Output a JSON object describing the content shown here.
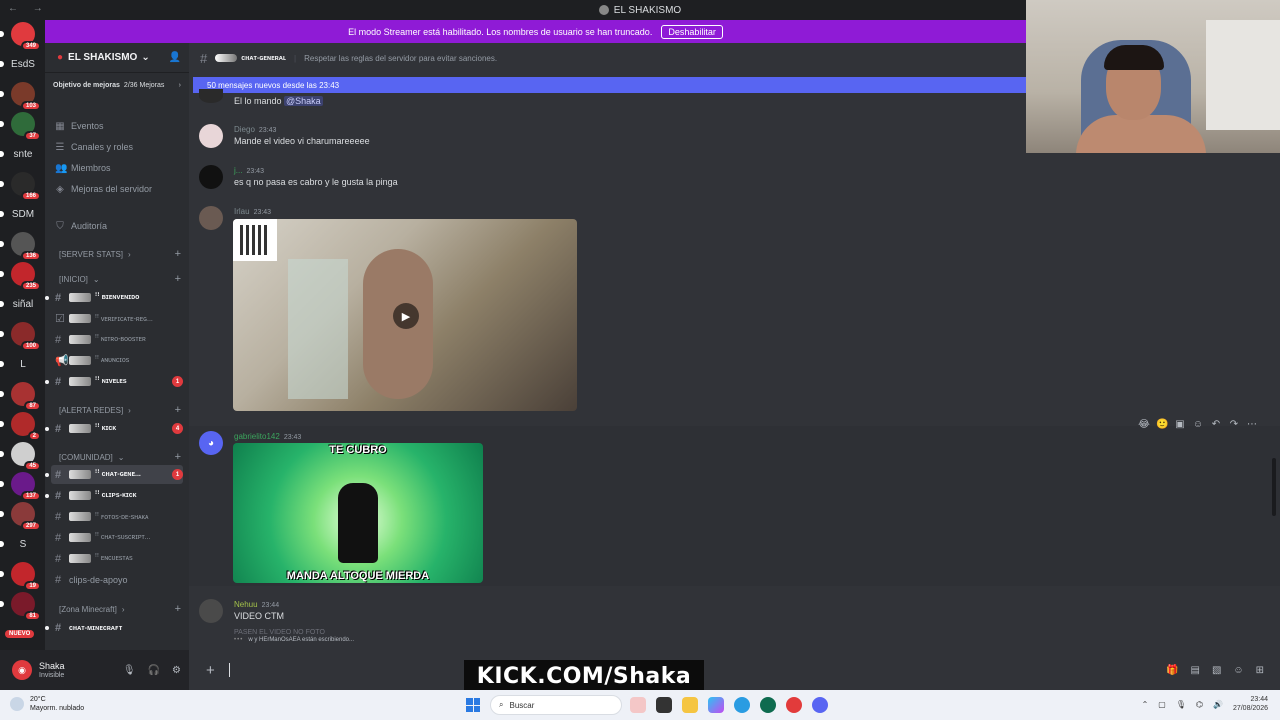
{
  "topbar": {
    "server_name": "EL SHAKISMO",
    "nav": "← →"
  },
  "banner": {
    "text": "El modo Streamer está habilitado. Los nombres de usuario se han truncado.",
    "button": "Deshabilitar"
  },
  "rail": [
    {
      "label": "349",
      "badge": "349",
      "kind": "icon"
    },
    {
      "label": "EsdS",
      "kind": "text"
    },
    {
      "label": "",
      "badge": "103",
      "kind": "icon"
    },
    {
      "label": "",
      "badge": "37",
      "kind": "icon"
    },
    {
      "label": "snte",
      "kind": "text"
    },
    {
      "label": "",
      "badge": "166",
      "kind": "icon"
    },
    {
      "label": "SDM",
      "kind": "text"
    },
    {
      "label": "",
      "badge": "136",
      "kind": "icon"
    },
    {
      "label": "",
      "badge": "235",
      "kind": "icon"
    },
    {
      "label": "siñal",
      "kind": "text"
    },
    {
      "label": "",
      "badge": "100",
      "kind": "icon"
    },
    {
      "label": "L",
      "kind": "text"
    },
    {
      "label": "",
      "badge": "87",
      "kind": "icon"
    },
    {
      "label": "",
      "badge": "2",
      "kind": "icon"
    },
    {
      "label": "",
      "badge": "45",
      "kind": "icon"
    },
    {
      "label": "",
      "badge": "137",
      "kind": "icon"
    },
    {
      "label": "",
      "badge": "297",
      "kind": "icon"
    },
    {
      "label": "S",
      "kind": "text"
    },
    {
      "label": "",
      "badge": "19",
      "kind": "icon"
    },
    {
      "label": "",
      "badge": "81",
      "kind": "icon"
    }
  ],
  "rail_nuevo": "NUEVO",
  "sidebar": {
    "server": "EL SHAKISMO",
    "boost_label": "Objetivo de mejoras",
    "boost_value": "2/36 Mejoras",
    "nav": [
      "Eventos",
      "Canales y roles",
      "Miembros",
      "Mejoras del servidor",
      "Auditoría"
    ],
    "categories": [
      "[SERVER STATS]",
      "[INICIO]",
      "[ALERTA REDES]",
      "[COMUNIDAD]",
      "[Zona Minecraft]"
    ],
    "channels": [
      {
        "name": "ꜝꜝ ʙɪᴇɴᴠᴇɴɪᴅᴏ",
        "count": ""
      },
      {
        "name": "ꜝꜝ ᴠᴇʀɪꜰɪᴄᴀᴛᴇ-ʀᴇɢ...",
        "count": ""
      },
      {
        "name": "ꜝꜝ ɴɪᴛʀᴏ-ʙᴏᴏsᴛᴇʀ",
        "count": ""
      },
      {
        "name": "ꜝꜝ ᴀɴᴜɴᴄɪᴏs",
        "count": ""
      },
      {
        "name": "ꜝꜝ ɴɪᴠᴇʟᴇs",
        "count": "1"
      },
      {
        "name": "ꜝꜝ ᴋɪᴄᴋ",
        "count": "4"
      },
      {
        "name": "ꜝꜝ ᴄʜᴀᴛ-ɢᴇɴᴇ...",
        "count": "1"
      },
      {
        "name": "ꜝꜝ ᴄʟɪᴘs-ᴋɪᴄᴋ",
        "count": ""
      },
      {
        "name": "ꜝꜝ ꜰᴏᴛᴏs-ᴅᴇ-sʜᴀᴋᴀ",
        "count": ""
      },
      {
        "name": "ꜝꜝ ᴄʜᴀᴛ-sᴜsᴄʀɪᴘᴛ...",
        "count": ""
      },
      {
        "name": "ꜝꜝ ᴇɴᴄᴜᴇsᴛᴀs",
        "count": ""
      },
      {
        "name": "clips-de-apoyo",
        "count": ""
      },
      {
        "name": "ᴄʜᴀᴛ-ᴍɪɴᴇᴄʀᴀꜰᴛ",
        "count": ""
      }
    ]
  },
  "user": {
    "name": "Shaka",
    "status": "Invisible"
  },
  "chat": {
    "channel": "ᴄʜᴀᴛ-ɢᴇɴᴇʀᴀʟ",
    "topic": "Respetar las reglas del servidor para evitar sanciones.",
    "new_messages": "50 mensajes nuevos desde las 23:43",
    "messages": [
      {
        "author": "",
        "time": "",
        "text": "El lo mando ",
        "mention": "@Shaka"
      },
      {
        "author": "Diego",
        "time": "23:43",
        "text": "Mande  el video vi charumareeeee"
      },
      {
        "author": "j...",
        "time": "23:43",
        "text": "es q no pasa es cabro y le gusta la pinga"
      },
      {
        "author": "Irlau",
        "time": "23:43",
        "text": ""
      },
      {
        "author": "gabrielito142",
        "time": "23:43",
        "text": ""
      },
      {
        "author": "Nehuu",
        "time": "23:44",
        "text": "VIDEO CTM"
      }
    ],
    "meme_top": "TE CUBRO",
    "meme_bottom": "MANDA ALTOQUE MIERDA",
    "faded_line": "PASEN EL VIDEO NO FOTO",
    "typing": "w y HErManOsAEA están escribiendo..."
  },
  "overlay": {
    "kick": "KICK.COM/Shaka"
  },
  "taskbar": {
    "temp": "20°C",
    "weather": "Mayorm. nublado",
    "search": "Buscar",
    "time": "23:44",
    "date": "27/08/2026"
  },
  "colors": {
    "banner": "#8f1bd6",
    "newbar": "#5865f2",
    "badge": "#e03a3e"
  }
}
